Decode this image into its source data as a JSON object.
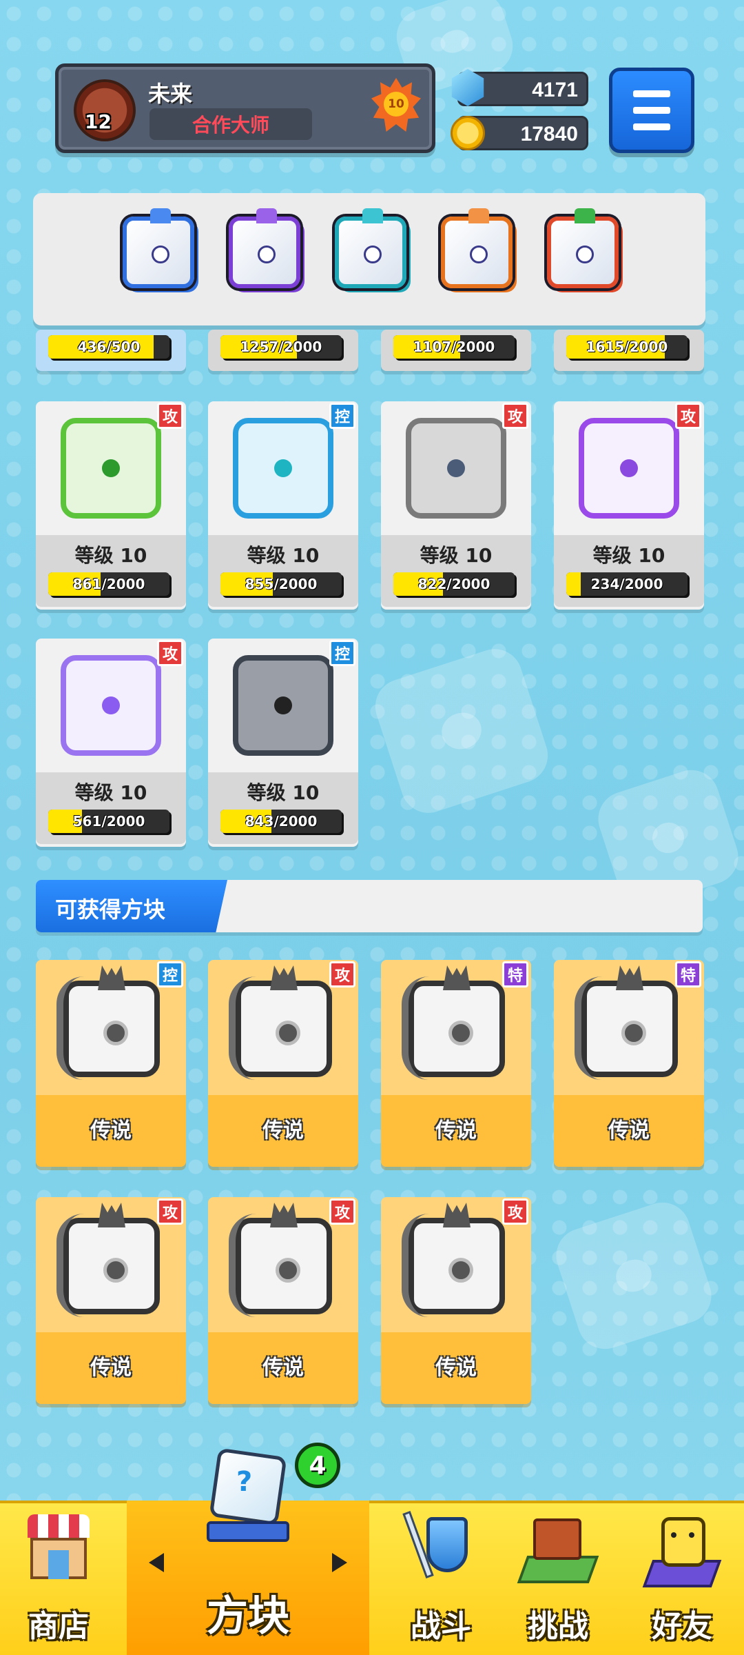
{
  "player": {
    "name": "未来",
    "title": "合作大师",
    "avatar_level": "12",
    "rank": "10"
  },
  "currency": {
    "gems": "4171",
    "coins": "17840"
  },
  "deck": {
    "slots": [
      {
        "color": "#2f6fe0",
        "crest": "#4a8af0"
      },
      {
        "color": "#7b3fd6",
        "crest": "#9a62e8"
      },
      {
        "color": "#1ea8b8",
        "crest": "#3cc4d2"
      },
      {
        "color": "#e8731e",
        "crest": "#f29244"
      },
      {
        "color": "#e04a2a",
        "crest": "#3cb44a"
      }
    ]
  },
  "partial_cards": [
    {
      "xp": "436/500",
      "fill": 0.87
    },
    {
      "xp": "1257/2000",
      "fill": 0.63
    },
    {
      "xp": "1107/2000",
      "fill": 0.55
    },
    {
      "xp": "1615/2000",
      "fill": 0.81
    }
  ],
  "owned_cards": [
    {
      "tag": "攻",
      "tag_type": "atk",
      "level": "等级 10",
      "xp": "861/2000",
      "fill": 0.43,
      "face": "#e6f6dc",
      "border": "#5cc43a",
      "pip": "#2d9a2d"
    },
    {
      "tag": "控",
      "tag_type": "ctl",
      "level": "等级 10",
      "xp": "855/2000",
      "fill": 0.43,
      "face": "#dff3fc",
      "border": "#2a9fe0",
      "pip": "#1eb4c2"
    },
    {
      "tag": "攻",
      "tag_type": "atk",
      "level": "等级 10",
      "xp": "822/2000",
      "fill": 0.41,
      "face": "#d8d8d8",
      "border": "#7a7a7a",
      "pip": "#4a5c78"
    },
    {
      "tag": "攻",
      "tag_type": "atk",
      "level": "等级 10",
      "xp": "234/2000",
      "fill": 0.12,
      "face": "#f6effd",
      "border": "#9a4ae8",
      "pip": "#8a4ae0"
    },
    {
      "tag": "攻",
      "tag_type": "atk",
      "level": "等级 10",
      "xp": "561/2000",
      "fill": 0.28,
      "face": "#f4efff",
      "border": "#9a74f0",
      "pip": "#8a5cf0"
    },
    {
      "tag": "控",
      "tag_type": "ctl",
      "level": "等级 10",
      "xp": "843/2000",
      "fill": 0.42,
      "face": "#9a9ea6",
      "border": "#3c4450",
      "pip": "#222"
    }
  ],
  "obtainable": {
    "title": "可获得方块",
    "cards": [
      {
        "tag": "控",
        "tag_type": "ctl",
        "label": "传说"
      },
      {
        "tag": "攻",
        "tag_type": "atk",
        "label": "传说"
      },
      {
        "tag": "特",
        "tag_type": "spc",
        "label": "传说"
      },
      {
        "tag": "特",
        "tag_type": "spc",
        "label": "传说"
      },
      {
        "tag": "攻",
        "tag_type": "atk",
        "label": "传说"
      },
      {
        "tag": "攻",
        "tag_type": "atk",
        "label": "传说"
      },
      {
        "tag": "攻",
        "tag_type": "atk",
        "label": "传说"
      }
    ]
  },
  "nav": {
    "shop": "商店",
    "blocks": "方块",
    "battle": "战斗",
    "challenge": "挑战",
    "friends": "好友",
    "blocks_badge": "4"
  },
  "icons": {
    "menu": "hamburger-menu-icon",
    "gem": "gem-icon",
    "coin": "coin-icon"
  }
}
